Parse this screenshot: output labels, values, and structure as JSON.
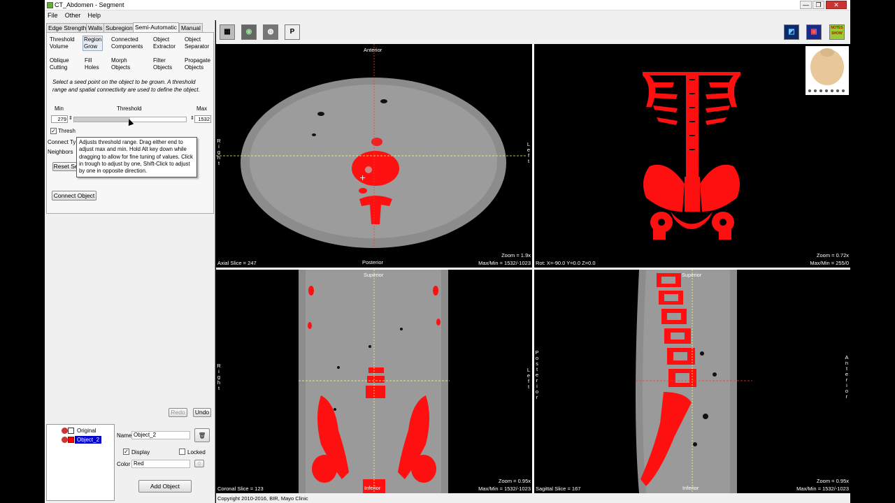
{
  "window": {
    "title": "CT_Abdomen - Segment",
    "min": "—",
    "max": "❐",
    "close": "✕"
  },
  "menu": [
    "File",
    "Other",
    "Help"
  ],
  "tabs": [
    "Edge Strength",
    "Walls",
    "Subregion",
    "Semi-Automatic",
    "Manual"
  ],
  "tools": {
    "threshold_volume": [
      "Threshold",
      "Volume"
    ],
    "region_grow": [
      "Region",
      "Grow"
    ],
    "connected_components": [
      "Connected",
      "Components"
    ],
    "object_extractor": [
      "Object",
      "Extractor"
    ],
    "object_separator": [
      "Object",
      "Separator"
    ],
    "oblique_cutting": [
      "Oblique",
      "Cutting"
    ],
    "fill_holes": [
      "Fill",
      "Holes"
    ],
    "morph_objects": [
      "Morph",
      "Objects"
    ],
    "filter_objects": [
      "Filter",
      "Objects"
    ],
    "propagate_objects": [
      "Propagate",
      "Objects"
    ]
  },
  "instructions": "Select a seed point on the object to be grown. A threshold range and spatial connectivity are used to define the object.",
  "threshold": {
    "min_label": "Min",
    "label": "Threshold",
    "max_label": "Max",
    "min_value": "279",
    "max_value": "1532",
    "range_low_fraction": 0.0,
    "range_high_fraction": 0.5
  },
  "options": {
    "threshold_check": "Thresh",
    "connect_type": "Connect Ty",
    "neighbors": "Neighbors",
    "reset_seeds": "Reset Seeds",
    "connect_object": "Connect Object"
  },
  "tooltip": "Adjusts threshold range. Drag either end to adjust max and min. Hold Alt key down while dragging to allow for fine tuning of values. Click in trough to adjust by one, Shift-Click to adjust by one in opposite direction.",
  "undo": {
    "redo": "Redo",
    "undo": "Undo"
  },
  "objects": [
    {
      "name": "Original",
      "color": "#ffffff",
      "selected": false
    },
    {
      "name": "Object_2",
      "color": "#ff0000",
      "selected": true
    }
  ],
  "props": {
    "name_label": "Name",
    "name_value": "Object_2",
    "display": "Display",
    "locked": "Locked",
    "color_label": "Color",
    "color_value": "Red",
    "add_object": "Add Object"
  },
  "toolbar_icons": [
    "layout-icon",
    "render-icon",
    "camera-icon",
    "preferences-icon"
  ],
  "toolbar_p": "P",
  "notes_icon": "NOTES SHOW",
  "views": {
    "axial": {
      "top": "Anterior",
      "bottom": "Posterior",
      "left": "Right",
      "right": "Left",
      "slice": "Axial Slice = 247",
      "zoom": "Zoom = 1.9x",
      "maxmin": "Max/Min = 1532/-1023"
    },
    "render": {
      "rot": "Rot: X=-90.0 Y=0.0 Z=0.0",
      "zoom": "Zoom = 0.72x",
      "maxmin": "Max/Min = 255/0"
    },
    "coronal": {
      "top": "Superior",
      "bottom": "Inferior",
      "left": "Right",
      "right": "Left",
      "slice": "Coronal Slice = 123",
      "zoom": "Zoom = 0.95x",
      "maxmin": "Max/Min = 1532/-1023"
    },
    "sagittal": {
      "top": "Superior",
      "bottom": "Inferior",
      "left": "Posterior",
      "right": "Anterior",
      "slice": "Sagittal Slice = 167",
      "zoom": "Zoom = 0.95x",
      "maxmin": "Max/Min = 1532/-1023"
    }
  },
  "copyright": "Copyright 2010-2016, BIR, Mayo Clinic",
  "colors": {
    "segment": "#ff1010",
    "tissue": "#9a9a9a",
    "crosshair": "#ffff66"
  }
}
